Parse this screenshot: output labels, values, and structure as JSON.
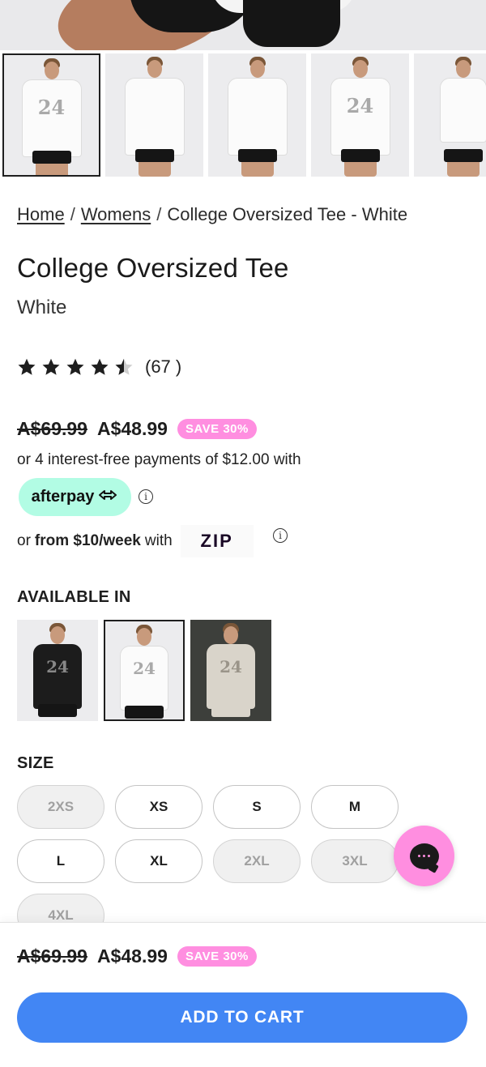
{
  "breadcrumb": {
    "home": "Home",
    "womens": "Womens",
    "current": "College Oversized Tee - White",
    "separator": "/"
  },
  "product": {
    "title": "College Oversized Tee",
    "color": "White",
    "rating": 4.5,
    "review_count": "(67 )",
    "old_price": "A$69.99",
    "new_price": "A$48.99",
    "save_badge": "SAVE 30%"
  },
  "payments": {
    "installments_text": "or 4 interest-free payments of $12.00 with",
    "afterpay_label": "afterpay",
    "zip_prefix": "or",
    "zip_amount": "from $10/week",
    "zip_suffix": "with",
    "zip_logo": "ZIP",
    "info_glyph": "i"
  },
  "available_in": {
    "label": "AVAILABLE IN",
    "swatches": [
      "black",
      "white",
      "grey"
    ],
    "selected": "white"
  },
  "size": {
    "label": "SIZE",
    "options": [
      {
        "label": "2XS",
        "available": false
      },
      {
        "label": "XS",
        "available": true
      },
      {
        "label": "S",
        "available": true
      },
      {
        "label": "M",
        "available": true
      },
      {
        "label": "L",
        "available": true
      },
      {
        "label": "XL",
        "available": true
      },
      {
        "label": "2XL",
        "available": false
      },
      {
        "label": "3XL",
        "available": false
      },
      {
        "label": "4XL",
        "available": false
      }
    ]
  },
  "sticky_bar": {
    "old_price": "A$69.99",
    "new_price": "A$48.99",
    "save_badge": "SAVE 30%",
    "add_to_cart": "ADD TO CART"
  },
  "colors": {
    "accent": "#4286f4",
    "badge": "#ff8ee0",
    "afterpay": "#b2fce4",
    "zip_purple": "#aa8fff"
  },
  "icons": {
    "star": "star-icon",
    "info": "info-icon",
    "chat": "chat-icon",
    "afterpay_arrows": "afterpay-arrows-icon"
  }
}
